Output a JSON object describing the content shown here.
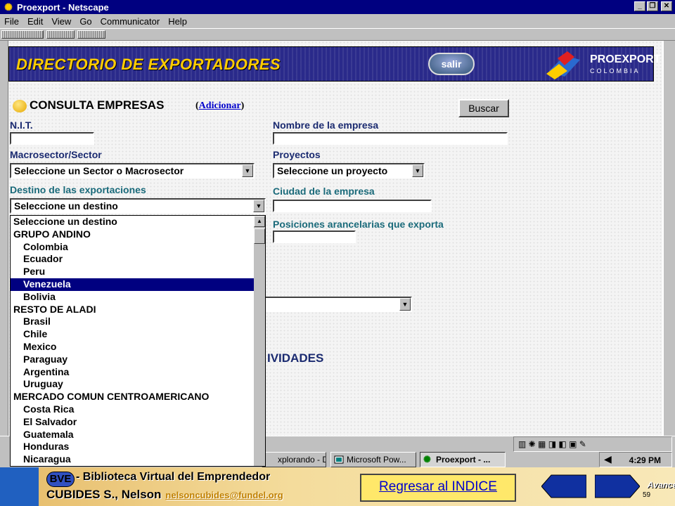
{
  "window": {
    "title": "Proexport - Netscape",
    "minimize": "_",
    "maximize": "❐",
    "close": "✕"
  },
  "menu": [
    "File",
    "Edit",
    "View",
    "Go",
    "Communicator",
    "Help"
  ],
  "banner": {
    "title": "DIRECTORIO DE EXPORTADORES",
    "salir": "salir",
    "logo_main": "PROEXPORT",
    "logo_sub": "COLOMBIA"
  },
  "form": {
    "heading": "CONSULTA EMPRESAS",
    "adicionar_open": "(",
    "adicionar_link": "Adicionar",
    "adicionar_close": ")",
    "buscar": "Buscar",
    "nit_label": "N.I.T.",
    "nombre_label": "Nombre de la empresa",
    "macrosector_label": "Macrosector/Sector",
    "macrosector_value": "Seleccione un Sector o Macrosector",
    "proyectos_label": "Proyectos",
    "proyectos_value": "Seleccione un proyecto",
    "destino_label": "Destino de las exportaciones",
    "destino_value": "Seleccione un destino",
    "ciudad_label": "Ciudad de la empresa",
    "posiciones_label": "Posiciones arancelarias que exporta",
    "actividades_partial": "IVIDADES"
  },
  "dropdown": {
    "items": [
      {
        "label": "Seleccione un destino",
        "indent": false,
        "selected": false
      },
      {
        "label": "GRUPO ANDINO",
        "indent": false,
        "selected": false
      },
      {
        "label": "Colombia",
        "indent": true,
        "selected": false
      },
      {
        "label": "Ecuador",
        "indent": true,
        "selected": false
      },
      {
        "label": "Peru",
        "indent": true,
        "selected": false
      },
      {
        "label": "Venezuela",
        "indent": true,
        "selected": true
      },
      {
        "label": "Bolivia",
        "indent": true,
        "selected": false
      },
      {
        "label": "RESTO DE ALADI",
        "indent": false,
        "selected": false
      },
      {
        "label": "Brasil",
        "indent": true,
        "selected": false
      },
      {
        "label": "Chile",
        "indent": true,
        "selected": false
      },
      {
        "label": "Mexico",
        "indent": true,
        "selected": false
      },
      {
        "label": "Paraguay",
        "indent": true,
        "selected": false
      },
      {
        "label": "Argentina",
        "indent": true,
        "selected": false
      },
      {
        "label": "Uruguay",
        "indent": true,
        "selected": false
      },
      {
        "label": "MERCADO COMUN CENTROAMERICANO",
        "indent": false,
        "selected": false
      },
      {
        "label": "Costa Rica",
        "indent": true,
        "selected": false
      },
      {
        "label": "El Salvador",
        "indent": true,
        "selected": false
      },
      {
        "label": "Guatemala",
        "indent": true,
        "selected": false
      },
      {
        "label": "Honduras",
        "indent": true,
        "selected": false
      },
      {
        "label": "Nicaragua",
        "indent": true,
        "selected": false
      }
    ]
  },
  "taskbar": {
    "task1": "xplorando - Di...",
    "task2": "Microsoft Pow...",
    "task3": "Proexport - ...",
    "clock": "4:29 PM"
  },
  "footer": {
    "bve": "BVE",
    "line1": "- Biblioteca Virtual del Emprendedor",
    "line2": "CUBIDES S., Nelson",
    "email": "nelsoncubides@fundel.org",
    "regresar": "Regresar al INDICE",
    "atras": "Atrás",
    "avance": "Avance",
    "page": "59"
  },
  "colors": {
    "title_bar": "#000080",
    "label_blue": "#1a2a70",
    "label_teal": "#1a6a7a",
    "selection": "#000080",
    "banner_title": "#ffcc00"
  }
}
